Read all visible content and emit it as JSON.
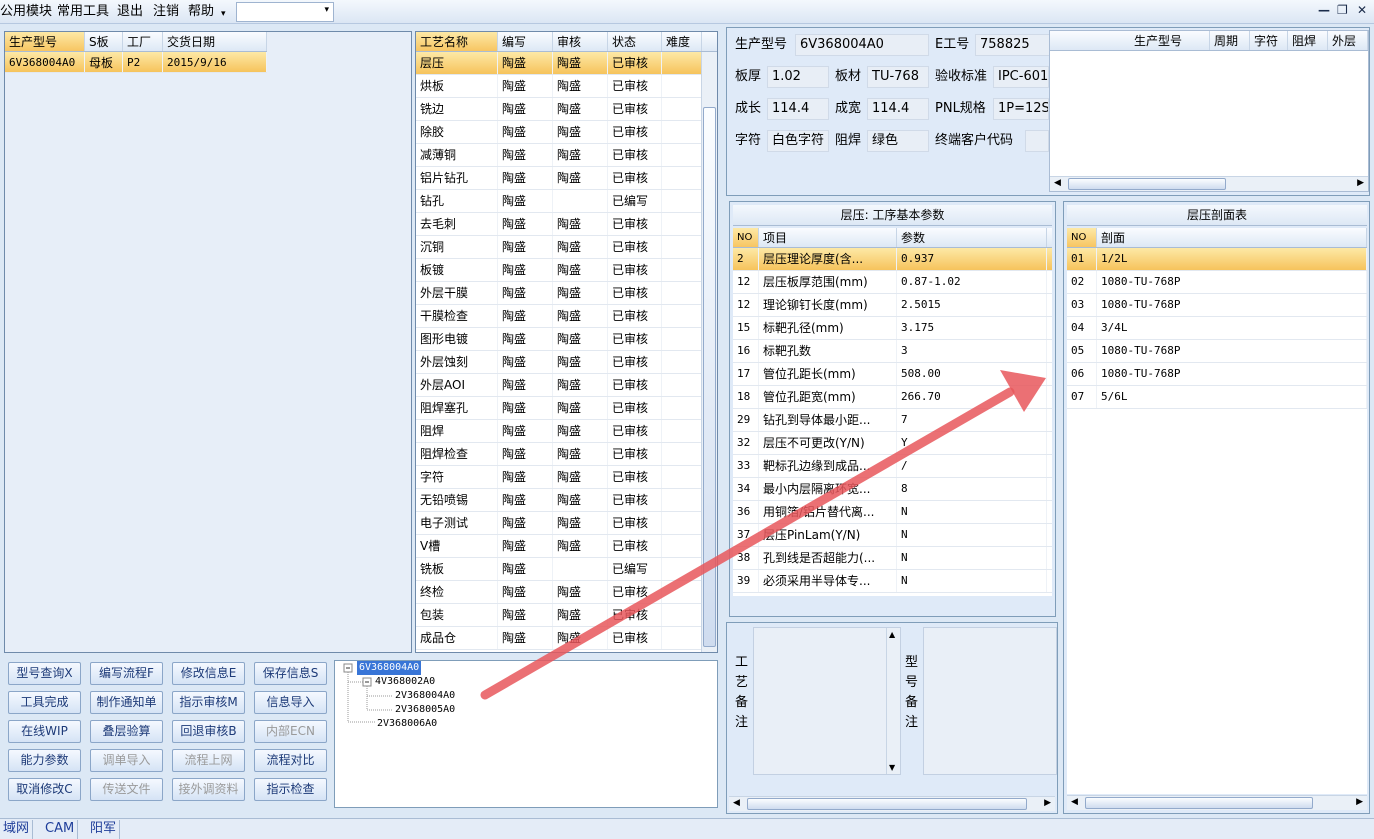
{
  "menu": {
    "items": [
      "公用模块",
      "常用工具",
      "退出",
      "注销",
      "帮助"
    ],
    "dropdown_arrow": "▾",
    "combo_value": ""
  },
  "window_controls": {
    "minimize": "—",
    "restore": "❐",
    "close": "✕"
  },
  "order_grid": {
    "headers": [
      "生产型号",
      "S板",
      "工厂",
      "交货日期"
    ],
    "rows": [
      [
        "6V368004A0",
        "母板",
        "P2",
        "2015/9/16"
      ]
    ]
  },
  "process_grid": {
    "headers": [
      "工艺名称",
      "编写",
      "审核",
      "状态",
      "难度"
    ],
    "rows": [
      [
        "层压",
        "陶盛",
        "陶盛",
        "已审核"
      ],
      [
        "烘板",
        "陶盛",
        "陶盛",
        "已审核"
      ],
      [
        "铣边",
        "陶盛",
        "陶盛",
        "已审核"
      ],
      [
        "除胶",
        "陶盛",
        "陶盛",
        "已审核"
      ],
      [
        "减薄铜",
        "陶盛",
        "陶盛",
        "已审核"
      ],
      [
        "铝片钻孔",
        "陶盛",
        "陶盛",
        "已审核"
      ],
      [
        "钻孔",
        "陶盛",
        "",
        "已编写"
      ],
      [
        "去毛刺",
        "陶盛",
        "陶盛",
        "已审核"
      ],
      [
        "沉铜",
        "陶盛",
        "陶盛",
        "已审核"
      ],
      [
        "板镀",
        "陶盛",
        "陶盛",
        "已审核"
      ],
      [
        "外层干膜",
        "陶盛",
        "陶盛",
        "已审核"
      ],
      [
        "干膜检查",
        "陶盛",
        "陶盛",
        "已审核"
      ],
      [
        "图形电镀",
        "陶盛",
        "陶盛",
        "已审核"
      ],
      [
        "外层蚀刻",
        "陶盛",
        "陶盛",
        "已审核"
      ],
      [
        "外层AOI",
        "陶盛",
        "陶盛",
        "已审核"
      ],
      [
        "阻焊塞孔",
        "陶盛",
        "陶盛",
        "已审核"
      ],
      [
        "阻焊",
        "陶盛",
        "陶盛",
        "已审核"
      ],
      [
        "阻焊检查",
        "陶盛",
        "陶盛",
        "已审核"
      ],
      [
        "字符",
        "陶盛",
        "陶盛",
        "已审核"
      ],
      [
        "无铅喷锡",
        "陶盛",
        "陶盛",
        "已审核"
      ],
      [
        "电子测试",
        "陶盛",
        "陶盛",
        "已审核"
      ],
      [
        "V槽",
        "陶盛",
        "陶盛",
        "已审核"
      ],
      [
        "铣板",
        "陶盛",
        "",
        "已编写"
      ],
      [
        "终检",
        "陶盛",
        "陶盛",
        "已审核"
      ],
      [
        "包装",
        "陶盛",
        "陶盛",
        "已审核"
      ],
      [
        "成品仓",
        "陶盛",
        "陶盛",
        "已审核"
      ]
    ]
  },
  "buttons": [
    [
      "型号查询X",
      "编写流程F",
      "修改信息E",
      "保存信息S"
    ],
    [
      "工具完成",
      "制作通知单",
      "指示审核M",
      "信息导入"
    ],
    [
      "在线WIP",
      "叠层验算",
      "回退审核B",
      "内部ECN"
    ],
    [
      "能力参数",
      "调单导入",
      "流程上网",
      "流程对比"
    ],
    [
      "取消修改C",
      "传送文件",
      "接外调资料",
      "指示检查"
    ]
  ],
  "tree": {
    "nodes": [
      "6V368004A0",
      "4V368002A0",
      "2V368004A0",
      "2V368005A0",
      "2V368006A0"
    ]
  },
  "info": {
    "prod_model_label": "生产型号",
    "prod_model": "6V368004A0",
    "e_label": "E工号",
    "e_value": "758825",
    "thick_label": "板厚",
    "thick": "1.02",
    "mat_label": "板材",
    "mat": "TU-768",
    "std_label": "验收标准",
    "std": "IPC-601",
    "len_label": "成长",
    "len": "114.4",
    "wid_label": "成宽",
    "wid": "114.4",
    "pnl_label": "PNL规格",
    "pnl": "1P=12S",
    "char_label": "字符",
    "char": "白色字符",
    "mask_label": "阻焊",
    "mask": "绿色",
    "cust_label": "终端客户代码",
    "cust": ""
  },
  "right_grid": {
    "headers": [
      "生产型号",
      "周期",
      "字符",
      "阻焊",
      "外层"
    ]
  },
  "params": {
    "title": "层压: 工序基本参数",
    "headers": [
      "NO",
      "项目",
      "参数"
    ],
    "rows": [
      [
        "2",
        "层压理论厚度(含...",
        "0.937"
      ],
      [
        "12",
        "层压板厚范围(mm)",
        "0.87-1.02"
      ],
      [
        "12",
        "理论铆钉长度(mm)",
        "2.5015"
      ],
      [
        "15",
        "标靶孔径(mm)",
        "3.175"
      ],
      [
        "16",
        "标靶孔数",
        "3"
      ],
      [
        "17",
        "管位孔距长(mm)",
        "508.00"
      ],
      [
        "18",
        "管位孔距宽(mm)",
        "266.70"
      ],
      [
        "29",
        "钻孔到导体最小距...",
        "7"
      ],
      [
        "32",
        "层压不可更改(Y/N)",
        "Y"
      ],
      [
        "33",
        "靶标孔边缘到成品...",
        "/"
      ],
      [
        "34",
        "最小内层隔离环宽...",
        "8"
      ],
      [
        "36",
        "用铜箔/铝片替代离...",
        "N"
      ],
      [
        "37",
        "层压PinLam(Y/N)",
        "N"
      ],
      [
        "38",
        "孔到线是否超能力(...",
        "N"
      ],
      [
        "39",
        "必须采用半导体专...",
        "N"
      ]
    ]
  },
  "stackup": {
    "title": "层压剖面表",
    "headers": [
      "NO",
      "剖面"
    ],
    "rows": [
      [
        "01",
        "1/2L"
      ],
      [
        "02",
        "1080-TU-768P"
      ],
      [
        "03",
        "1080-TU-768P"
      ],
      [
        "04",
        "3/4L"
      ],
      [
        "05",
        "1080-TU-768P"
      ],
      [
        "06",
        "1080-TU-768P"
      ],
      [
        "07",
        "5/6L"
      ]
    ]
  },
  "notes": {
    "process_label": "工艺备注",
    "model_label": "型号备注"
  },
  "status": {
    "items": [
      "域网",
      "CAM",
      "阳军"
    ]
  },
  "colors": {
    "selection": "#f7c562",
    "accent": "#1f3e9a",
    "arrow": "#e8575c"
  }
}
